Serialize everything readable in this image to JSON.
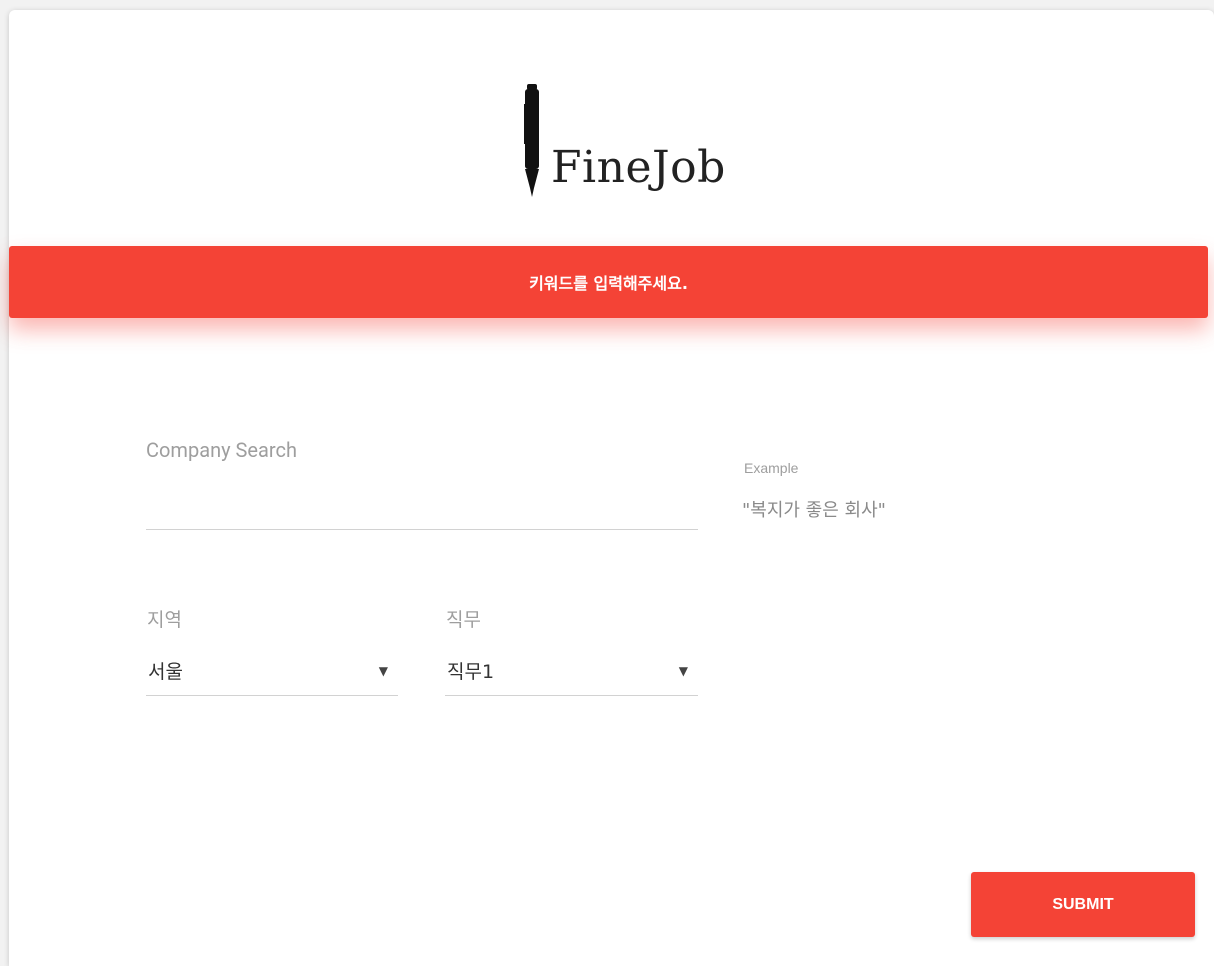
{
  "brand": {
    "logo_text": "FineJob",
    "logo_icon": "fountain-pen-icon"
  },
  "alert": {
    "message": "키워드를 입력해주세요.",
    "color": "#f44336"
  },
  "search": {
    "label": "Company Search",
    "value": "",
    "example_label": "Example",
    "example_text": "\"복지가 좋은 회사\""
  },
  "region": {
    "label": "지역",
    "selected": "서울"
  },
  "job": {
    "label": "직무",
    "selected": "직무1"
  },
  "actions": {
    "submit_label": "SUBMIT"
  },
  "colors": {
    "accent": "#f44336",
    "label_gray": "#9e9e9e"
  }
}
